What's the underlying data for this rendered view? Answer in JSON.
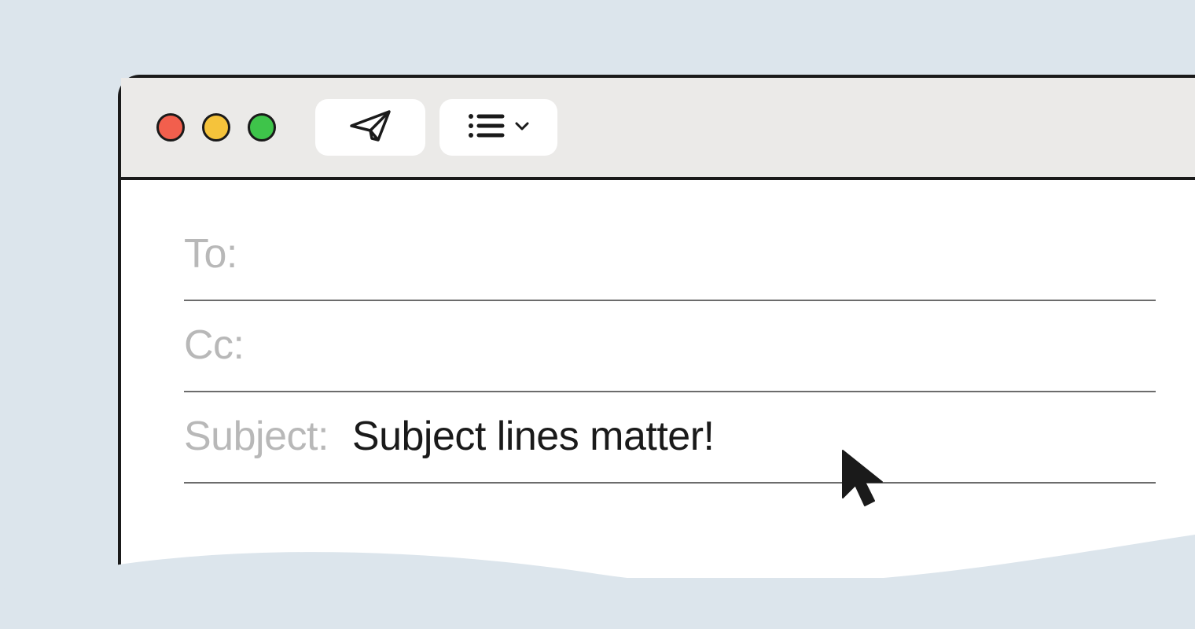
{
  "window": {
    "traffic_lights": {
      "close_color": "#F25F4D",
      "minimize_color": "#F5C33B",
      "zoom_color": "#3EC44A"
    },
    "toolbar": {
      "send_icon": "paper-airplane-icon",
      "list_icon": "list-icon",
      "dropdown_icon": "chevron-down-icon"
    }
  },
  "compose": {
    "fields": {
      "to": {
        "label": "To:",
        "value": ""
      },
      "cc": {
        "label": "Cc:",
        "value": ""
      },
      "subject": {
        "label": "Subject:",
        "value": "Subject lines matter!"
      }
    }
  }
}
